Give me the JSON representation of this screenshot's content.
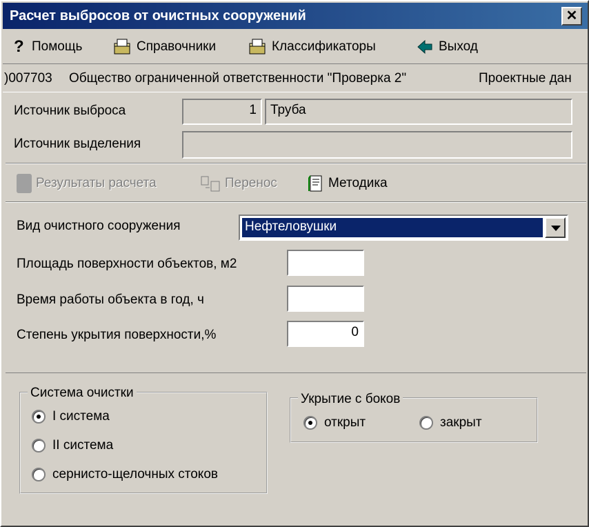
{
  "window": {
    "title": "Расчет выбросов от очистных сооружений",
    "close_glyph": "✕"
  },
  "menu": {
    "help": "Помощь",
    "references": "Справочники",
    "classifiers": "Классификаторы",
    "exit": "Выход"
  },
  "info": {
    "code": ")007703",
    "org": "Общество ограниченной ответственности \"Проверка 2\"",
    "project": "Проектные дан"
  },
  "source": {
    "emission_label": "Источник выброса",
    "emission_number": "1",
    "emission_name": "Труба",
    "release_label": "Источник выделения",
    "release_value": ""
  },
  "toolbar": {
    "results": "Результаты расчета",
    "transfer": "Перенос",
    "method": "Методика"
  },
  "form": {
    "facility_type_label": "Вид очистного сооружения",
    "facility_type_value": "Нефтеловушки",
    "area_label": "Площадь поверхности объектов, м2",
    "area_value": "",
    "hours_label": "Время работы объекта в год, ч",
    "hours_value": "",
    "cover_label": "Степень укрытия поверхности,%",
    "cover_value": "0"
  },
  "cleaning": {
    "title": "Система очистки",
    "options": [
      "I система",
      "II система",
      "сернисто-щелочных стоков"
    ],
    "selected": 0
  },
  "side_cover": {
    "title": "Укрытие с боков",
    "open": "открыт",
    "closed": "закрыт",
    "selected": "open"
  }
}
